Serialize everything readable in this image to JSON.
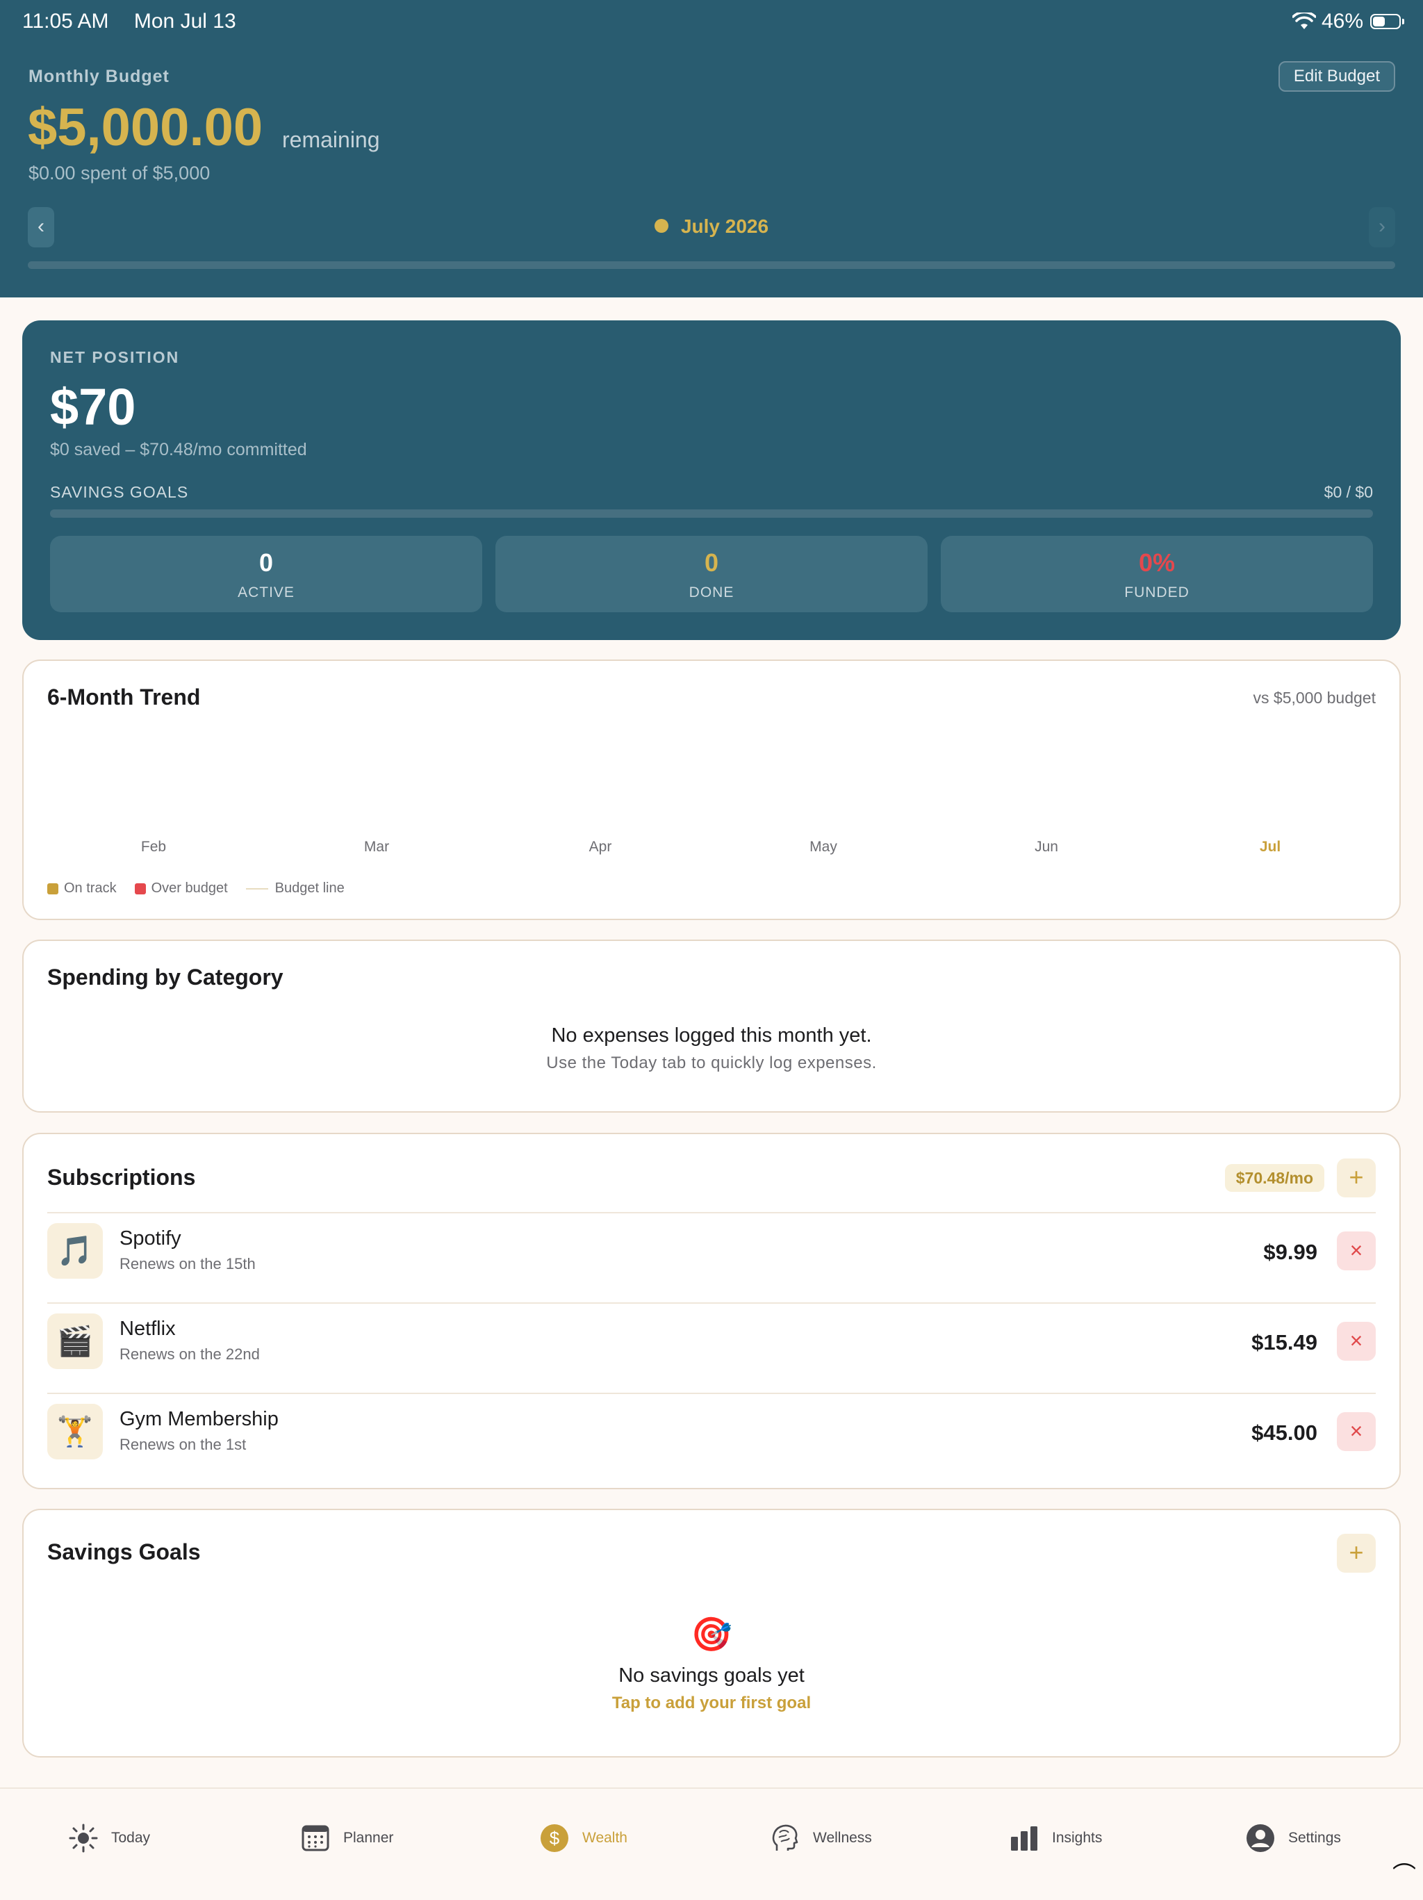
{
  "status": {
    "time": "11:05 AM",
    "date": "Mon Jul 13",
    "battery": "46%",
    "battery_level": 0.46
  },
  "header": {
    "label": "Monthly Budget",
    "edit_label": "Edit Budget",
    "amount": "$5,000.00",
    "remaining": "remaining",
    "spent": "$0.00 spent of $5,000",
    "prev": "‹",
    "next": "›",
    "month": "July 2026",
    "month_progress": 0.0
  },
  "net": {
    "label": "NET POSITION",
    "value": "$70",
    "sub": "$0 saved – $70.48/mo committed",
    "goals_label": "SAVINGS GOALS",
    "goals_value": "$0 / $0",
    "goals_progress": 0.0,
    "stats": [
      {
        "num": "0",
        "label": "ACTIVE",
        "color": "#ffffff"
      },
      {
        "num": "0",
        "label": "DONE",
        "color": "#d6b44f"
      },
      {
        "num": "0%",
        "label": "FUNDED",
        "color": "#e5484d"
      }
    ]
  },
  "trend": {
    "title": "6-Month Trend",
    "note": "vs $5,000 budget",
    "months": [
      "Feb",
      "Mar",
      "Apr",
      "May",
      "Jun",
      "Jul"
    ],
    "current_month": "Jul",
    "legend": [
      {
        "label": "On track",
        "color": "#c9a03a"
      },
      {
        "label": "Over budget",
        "color": "#e5484d"
      },
      {
        "label": "Budget line",
        "color": "#e8dcc0"
      }
    ]
  },
  "spending": {
    "title": "Spending by Category",
    "empty_title": "No expenses logged this month yet.",
    "empty_sub": "Use the Today tab to quickly log expenses."
  },
  "subscriptions": {
    "title": "Subscriptions",
    "total": "$70.48/mo",
    "add": "+",
    "delete": "×",
    "items": [
      {
        "icon": "🎵",
        "icon_name": "music-note-icon",
        "name": "Spotify",
        "renew": "Renews on the 15th",
        "price": "$9.99"
      },
      {
        "icon": "🎬",
        "icon_name": "clapper-board-icon",
        "name": "Netflix",
        "renew": "Renews on the 22nd",
        "price": "$15.49"
      },
      {
        "icon": "🏋",
        "icon_name": "weightlifter-icon",
        "name": "Gym Membership",
        "renew": "Renews on the 1st",
        "price": "$45.00"
      }
    ]
  },
  "goals": {
    "title": "Savings Goals",
    "add": "+",
    "emoji": "🎯",
    "empty_title": "No savings goals yet",
    "empty_link": "Tap to add your first goal"
  },
  "tabs": [
    {
      "label": "Today",
      "icon": "sun-icon",
      "active": false
    },
    {
      "label": "Planner",
      "icon": "calendar-icon",
      "active": false
    },
    {
      "label": "Wealth",
      "icon": "dollar-coin-icon",
      "active": true
    },
    {
      "label": "Wellness",
      "icon": "brain-head-icon",
      "active": false
    },
    {
      "label": "Insights",
      "icon": "bar-chart-icon",
      "active": false
    },
    {
      "label": "Settings",
      "icon": "person-circle-icon",
      "active": false
    }
  ],
  "colors": {
    "primary": "#295c70",
    "accent": "#d6b44f",
    "danger": "#e5484d",
    "background": "#fdf8f4"
  }
}
